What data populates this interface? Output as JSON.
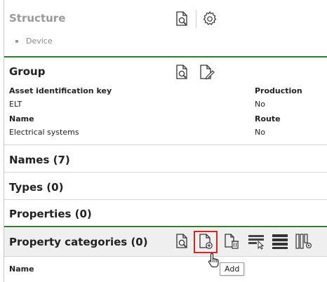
{
  "structure": {
    "title": "Structure",
    "items": [
      "Device"
    ],
    "icons": [
      "search-document-icon",
      "settings-gear-icon"
    ]
  },
  "group": {
    "title": "Group",
    "icons": [
      "search-document-icon",
      "edit-document-icon"
    ],
    "fields": {
      "asset_key_label": "Asset identification key",
      "asset_key_value": "ELT",
      "production_label": "Production",
      "production_value": "No",
      "name_label": "Name",
      "name_value": "Electrical systems",
      "route_label": "Route",
      "route_value": "No"
    }
  },
  "names": {
    "title": "Names (7)"
  },
  "types": {
    "title": "Types (0)"
  },
  "properties": {
    "title": "Properties (0)"
  },
  "property_categories": {
    "title": "Property categories (0)",
    "icons": [
      "search-document-icon",
      "add-document-icon",
      "delete-document-icon",
      "select-rows-icon",
      "stacked-rows-icon",
      "column-settings-icon"
    ],
    "column_header": "Name"
  },
  "tooltip": {
    "text": "Add"
  },
  "colors": {
    "accent_green": "#2e7d32",
    "focus_red": "#d22222",
    "row_active": "#efefef"
  }
}
